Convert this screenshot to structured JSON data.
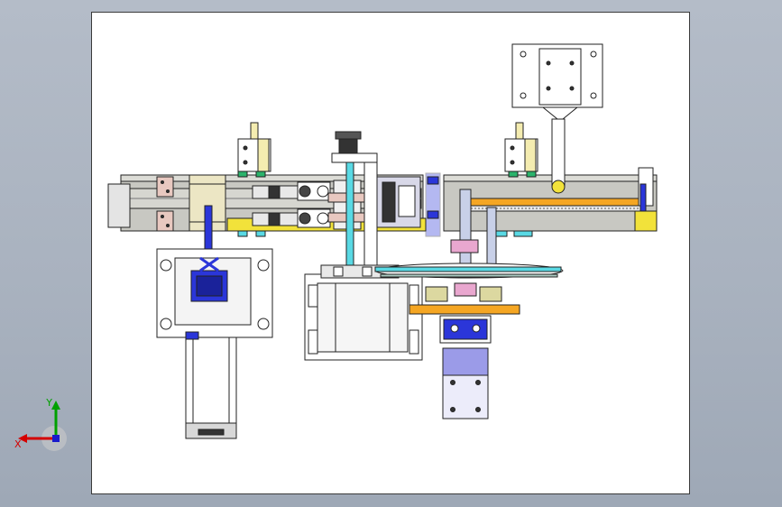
{
  "viewport": {
    "background": "#aab3c0",
    "sheet_color": "#ffffff"
  },
  "triad": {
    "x_label": "X",
    "y_label": "Y",
    "x_color": "#d40000",
    "y_color": "#00a000",
    "z_color": "#1a1acc"
  },
  "model": {
    "palette": {
      "rail": "#c8c8c2",
      "yellow_plate": "#f2e23a",
      "orange_plate": "#f5a623",
      "cyan_rod": "#59d9e4",
      "blue_part": "#2b36d9",
      "lavender_block": "#9b9be8",
      "pink_coupling": "#e9a7cf",
      "green_accent": "#2bb36b",
      "dark_part": "#333333",
      "light_gray": "#e4e4e4"
    },
    "parts": [
      {
        "name": "left-servo-motor",
        "interactable": true
      },
      {
        "name": "left-slide-rail",
        "interactable": true
      },
      {
        "name": "gripper-assembly",
        "interactable": true
      },
      {
        "name": "center-housing",
        "interactable": true
      },
      {
        "name": "vertical-support-column",
        "interactable": true
      },
      {
        "name": "right-slide-rail",
        "interactable": true
      },
      {
        "name": "top-mounting-bracket",
        "interactable": true
      },
      {
        "name": "turntable-disc",
        "interactable": true
      },
      {
        "name": "bottom-drive-motor",
        "interactable": true
      }
    ]
  }
}
